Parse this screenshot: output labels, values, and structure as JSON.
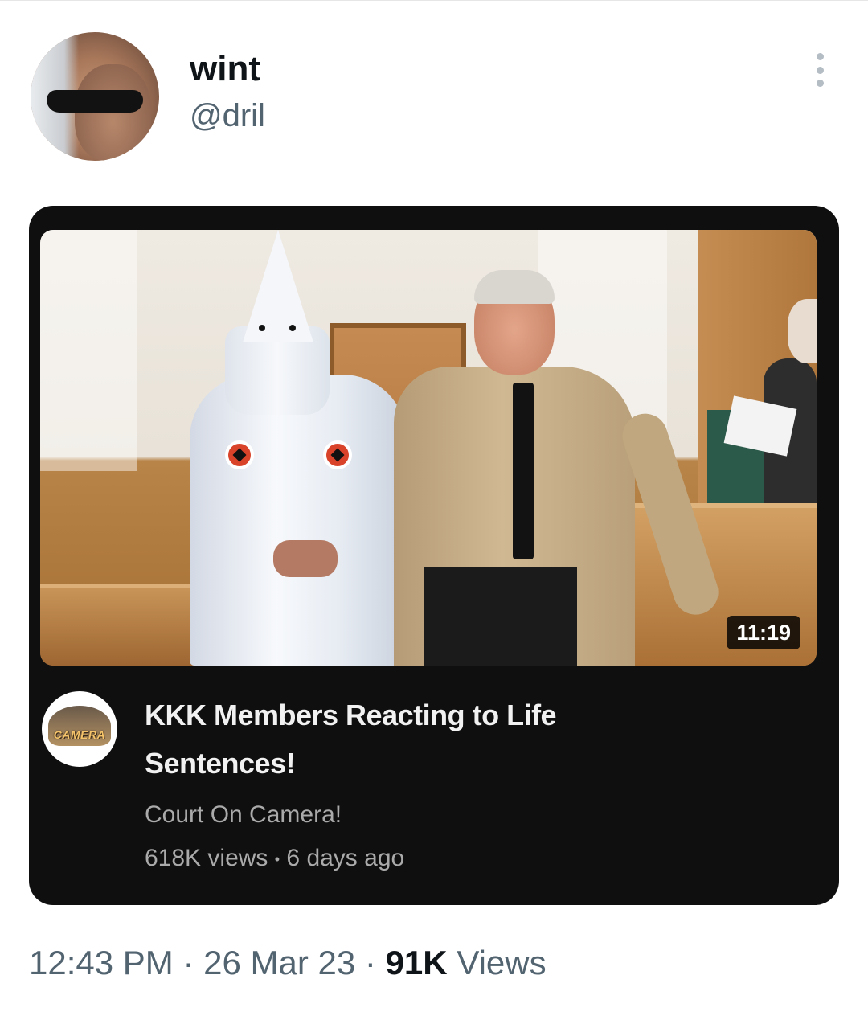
{
  "tweet": {
    "display_name": "wint",
    "handle": "@dril",
    "time": "12:43 PM",
    "date": "26 Mar 23",
    "views_count": "91K",
    "views_label": "Views",
    "separator": "·"
  },
  "video_card": {
    "title": "KKK Members Reacting to Life Sentences!",
    "channel": "Court On Camera!",
    "views": "618K views",
    "age": "6 days ago",
    "meta_separator": "•",
    "duration": "11:19",
    "channel_logo_text": "CAMERA"
  },
  "icons": {
    "more": "more-vertical-icon"
  },
  "colors": {
    "card_background": "#0f0f0f",
    "secondary_text": "#536471",
    "primary_text": "#0f1419"
  }
}
